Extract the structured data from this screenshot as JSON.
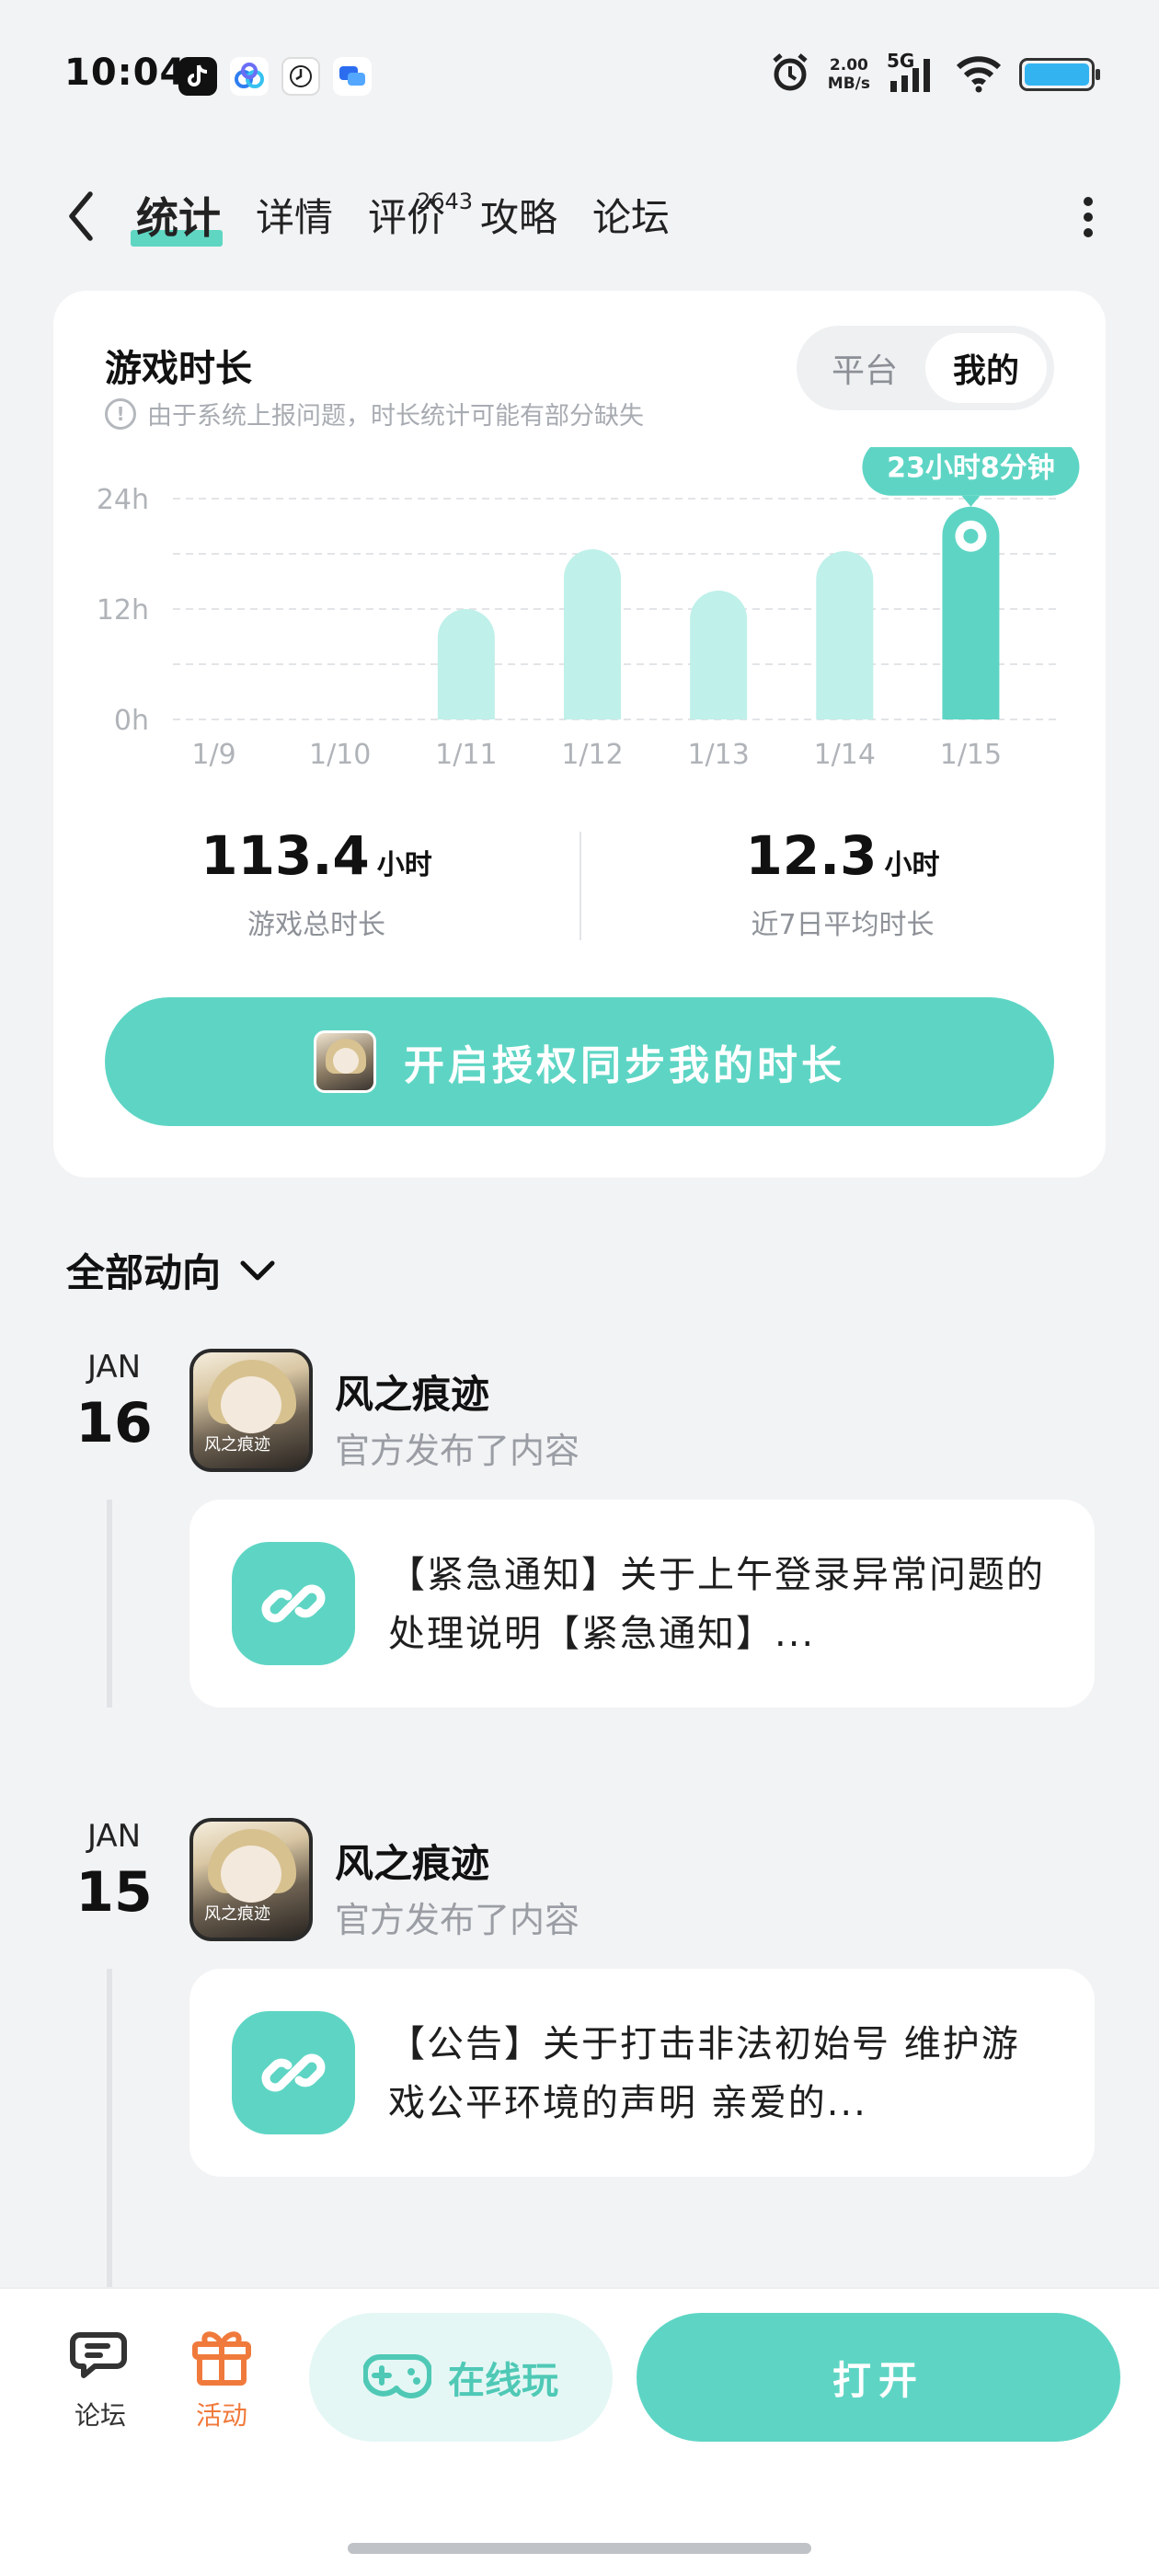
{
  "status_bar": {
    "time": "10:04",
    "speed_value": "2.00",
    "speed_unit": "MB/s",
    "network": "5G",
    "icons": [
      "tiktok-icon",
      "baidu-netdisk-icon",
      "clock-app-icon",
      "chat-app-icon",
      "alarm-icon",
      "signal-icon",
      "wifi-icon",
      "battery-icon"
    ]
  },
  "nav": {
    "tabs": [
      {
        "label": "统计",
        "active": true
      },
      {
        "label": "详情"
      },
      {
        "label": "评价",
        "badge": "2643"
      },
      {
        "label": "攻略"
      },
      {
        "label": "论坛"
      }
    ]
  },
  "playtime": {
    "title": "游戏时长",
    "note": "由于系统上报问题，时长统计可能有部分缺失",
    "toggle": [
      "平台",
      "我的"
    ],
    "toggle_selected": "我的",
    "total_value": "113.4",
    "total_unit": "小时",
    "total_label": "游戏总时长",
    "avg_value": "12.3",
    "avg_unit": "小时",
    "avg_label": "近7日平均时长",
    "sync_button": "开启授权同步我的时长"
  },
  "chart_data": {
    "type": "bar",
    "categories": [
      "1/9",
      "1/10",
      "1/11",
      "1/12",
      "1/13",
      "1/14",
      "1/15"
    ],
    "values": [
      0,
      0,
      12,
      18.5,
      14,
      18.3,
      23.13
    ],
    "ylim": [
      0,
      24
    ],
    "yticks": [
      "0h",
      "12h",
      "24h"
    ],
    "tooltip": "23小时8分钟",
    "highlight_index": 6,
    "grid": true,
    "colors": {
      "bar": "#bff0ea",
      "highlight": "#5ed5c4"
    }
  },
  "feed": {
    "title": "全部动向",
    "entries": [
      {
        "month": "JAN",
        "day": "16",
        "author": "风之痕迹",
        "action": "官方发布了内容",
        "text": "【紧急通知】关于上午登录异常问题的处理说明【紧急通知】..."
      },
      {
        "month": "JAN",
        "day": "15",
        "author": "风之痕迹",
        "action": "官方发布了内容",
        "text": "【公告】关于打击非法初始号 维护游戏公平环境的声明 亲爱的..."
      }
    ],
    "avatar_caption": "风之痕迹"
  },
  "bottom_bar": {
    "forum_label": "论坛",
    "activity_label": "活动",
    "online_label": "在线玩",
    "open_label": "打开",
    "colors": {
      "accent": "#5ed5c4",
      "activity": "#f07a3c"
    }
  }
}
